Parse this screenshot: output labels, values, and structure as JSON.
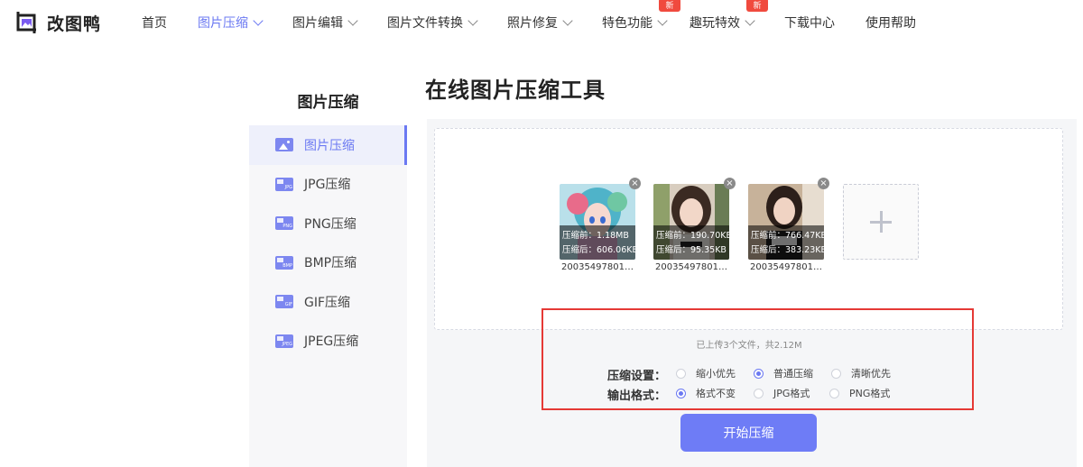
{
  "app": {
    "name": "改图鸭"
  },
  "nav": {
    "items": [
      {
        "label": "首页",
        "dropdown": false,
        "active": false,
        "badge": ""
      },
      {
        "label": "图片压缩",
        "dropdown": true,
        "active": true,
        "badge": ""
      },
      {
        "label": "图片编辑",
        "dropdown": true,
        "active": false,
        "badge": ""
      },
      {
        "label": "图片文件转换",
        "dropdown": true,
        "active": false,
        "badge": ""
      },
      {
        "label": "照片修复",
        "dropdown": true,
        "active": false,
        "badge": ""
      },
      {
        "label": "特色功能",
        "dropdown": true,
        "active": false,
        "badge": "新"
      },
      {
        "label": "趣玩特效",
        "dropdown": true,
        "active": false,
        "badge": "新"
      },
      {
        "label": "下载中心",
        "dropdown": false,
        "active": false,
        "badge": ""
      },
      {
        "label": "使用帮助",
        "dropdown": false,
        "active": false,
        "badge": ""
      }
    ]
  },
  "sidebar": {
    "title": "图片压缩",
    "items": [
      {
        "label": "图片压缩",
        "icon": "image-icon",
        "tag": "",
        "active": true
      },
      {
        "label": "JPG压缩",
        "icon": "jpg-file-icon",
        "tag": "JPG",
        "active": false
      },
      {
        "label": "PNG压缩",
        "icon": "png-file-icon",
        "tag": "PNG",
        "active": false
      },
      {
        "label": "BMP压缩",
        "icon": "bmp-file-icon",
        "tag": "BMP",
        "active": false
      },
      {
        "label": "GIF压缩",
        "icon": "gif-file-icon",
        "tag": "GIF",
        "active": false
      },
      {
        "label": "JPEG压缩",
        "icon": "jpeg-file-icon",
        "tag": "JPEG",
        "active": false
      }
    ]
  },
  "main": {
    "title": "在线图片压缩工具",
    "files": [
      {
        "before": "压缩前：1.18MB",
        "after": "压缩后：606.06KB",
        "name": "20035497801…"
      },
      {
        "before": "压缩前：190.70KB",
        "after": "压缩后：95.35KB",
        "name": "20035497801…"
      },
      {
        "before": "压缩前：766.47KB",
        "after": "压缩后：383.23KB",
        "name": "20035497801…"
      }
    ],
    "summary": "已上传3个文件，共2.12M",
    "compress_setting": {
      "label": "压缩设置：",
      "options": [
        {
          "label": "缩小优先",
          "checked": false
        },
        {
          "label": "普通压缩",
          "checked": true
        },
        {
          "label": "清晰优先",
          "checked": false
        }
      ]
    },
    "output_format": {
      "label": "输出格式：",
      "options": [
        {
          "label": "格式不变",
          "checked": true
        },
        {
          "label": "JPG格式",
          "checked": false
        },
        {
          "label": "PNG格式",
          "checked": false
        }
      ]
    },
    "start_button": "开始压缩"
  },
  "colors": {
    "accent": "#6b79f2",
    "highlight": "#e53935",
    "badge": "#f04a3e"
  }
}
